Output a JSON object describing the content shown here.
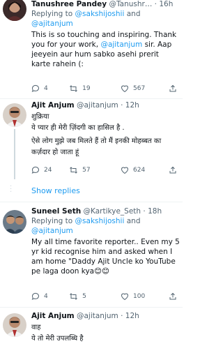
{
  "tweets": [
    {
      "name": "Tanushree Pandey",
      "handle": "@Tanushr…",
      "time": "16h",
      "replying_prefix": "Replying to",
      "replying_to_1": "@sakshijoshii",
      "replying_and": "and",
      "replying_to_2": "@ajitanjum",
      "text_1": "This is so touching and inspiring. Thank you for your work,",
      "mention": "@ajitanjum",
      "text_2": "sir. Aap jeeyein aur hum sabko asehi prerit karte rahein (:",
      "replies": "4",
      "retweets": "19",
      "likes": "567"
    },
    {
      "name": "Ajit Anjum",
      "handle": "@ajitanjum",
      "time": "12h",
      "line_1": "शुक्रिया",
      "line_2": "ये प्यार ही मेरी ज़िंदगी का हासिल है .",
      "line_3": "ऐसे लोग मुझे जब मिलते हैं तो मैं इनकी मोहब्बत का कर्ज़दार हो जाता हूं",
      "replies": "24",
      "retweets": "57",
      "likes": "624"
    },
    {
      "name": "Suneel Seth",
      "handle": "@Kartikye_Seth",
      "time": "18h",
      "replying_prefix": "Replying to",
      "replying_to_1": "@sakshijoshii",
      "replying_and": "and",
      "replying_to_2": "@ajitanjum",
      "text": "My all time favorite reporter.. Even my 5 yr kid recognise him and asked when I am home \"Daddy Ajit Uncle ko YouTube pe laga doon kya😊😊",
      "replies": "4",
      "retweets": "5",
      "likes": "100"
    },
    {
      "name": "Ajit Anjum",
      "handle": "@ajitanjum",
      "time": "12h",
      "line_1": "वाह",
      "line_2": "ये तो मेरी उपलब्धि है"
    }
  ],
  "show_replies": "Show replies",
  "colors": {
    "link": "#1d9bf0",
    "muted": "#536471",
    "separator": "#eff3f4"
  },
  "icons": [
    "reply-icon",
    "retweet-icon",
    "like-icon",
    "share-icon"
  ]
}
